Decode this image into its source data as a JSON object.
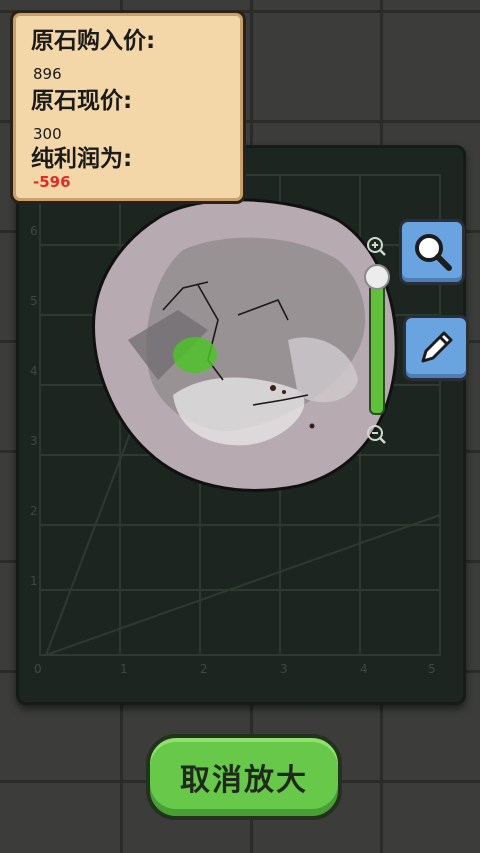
{
  "info_card": {
    "purchase_price_label": "原石购入价:",
    "purchase_price_value": "896",
    "current_price_label": "原石现价:",
    "current_price_value": "300",
    "net_profit_label": "纯利润为:",
    "net_profit_value": "-596"
  },
  "grid": {
    "y_ticks": [
      "6",
      "5",
      "4",
      "3",
      "2",
      "1"
    ],
    "x_ticks": [
      "0",
      "1",
      "2",
      "3",
      "4",
      "5"
    ]
  },
  "tools": {
    "magnifier_icon": "magnifier-icon",
    "pencil_icon": "pencil-icon"
  },
  "zoom_slider": {
    "level": 1.0
  },
  "buttons": {
    "cancel_zoom_label": "取消放大"
  },
  "colors": {
    "card_bg": "#f3d7a8",
    "profit_negative": "#e22a2a",
    "button_green": "#67c84a",
    "tool_blue": "#6aa4e0"
  }
}
